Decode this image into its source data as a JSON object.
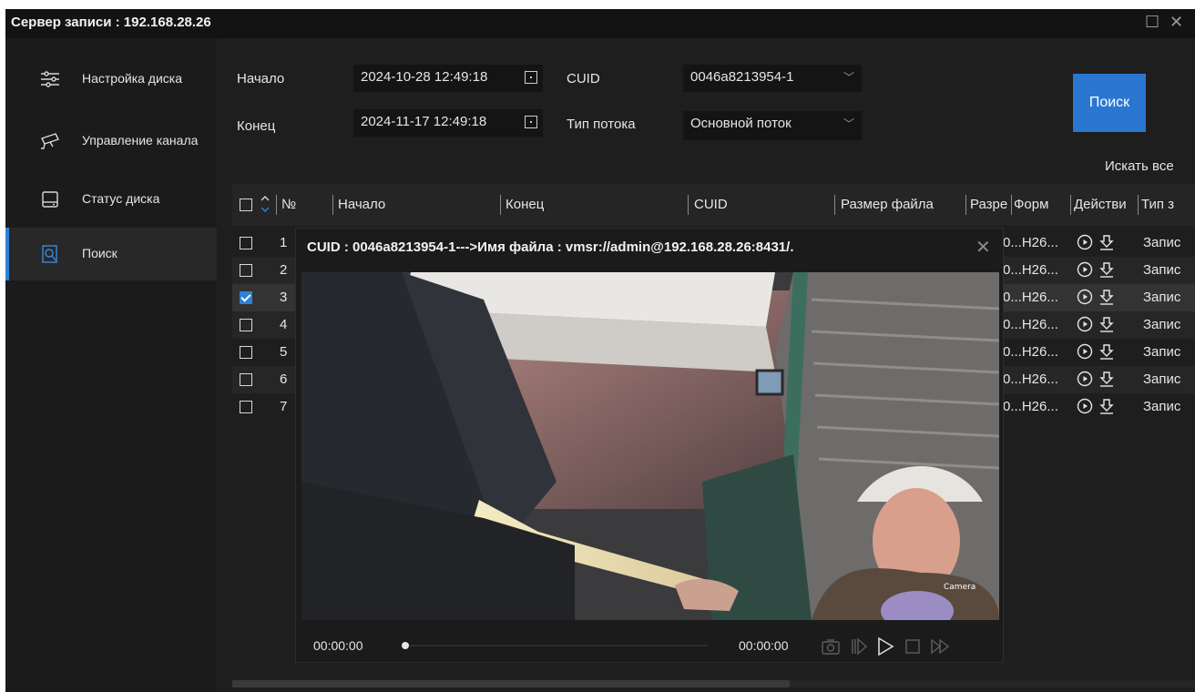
{
  "window": {
    "title": "Сервер записи : 192.168.28.26"
  },
  "sidebar": {
    "items": [
      {
        "label": "Настройка диска",
        "icon": "sliders-icon"
      },
      {
        "label": "Управление канала",
        "icon": "camera-icon"
      },
      {
        "label": "Статус диска",
        "icon": "disk-icon"
      },
      {
        "label": "Поиск",
        "icon": "search-doc-icon"
      }
    ]
  },
  "filters": {
    "start_label": "Начало",
    "start_value": "2024-10-28 12:49:18",
    "end_label": "Конец",
    "end_value": "2024-11-17 12:49:18",
    "cuid_label": "CUID",
    "cuid_value": "0046a8213954-1",
    "stream_label": "Тип потока",
    "stream_value": "Основной поток"
  },
  "search_button": "Поиск",
  "search_all": "Искать все",
  "table": {
    "columns": [
      "№",
      "Начало",
      "Конец",
      "CUID",
      "Размер файла",
      "Разре",
      "Форм",
      "Действи",
      "Тип з"
    ],
    "rows": [
      {
        "no": "1",
        "format": "0...H26...",
        "type": "Запис",
        "checked": false
      },
      {
        "no": "2",
        "format": "0...H26...",
        "type": "Запис",
        "checked": false
      },
      {
        "no": "3",
        "format": "0...H26...",
        "type": "Запис",
        "checked": true
      },
      {
        "no": "4",
        "format": "0...H26...",
        "type": "Запис",
        "checked": false
      },
      {
        "no": "5",
        "format": "0...H26...",
        "type": "Запис",
        "checked": false
      },
      {
        "no": "6",
        "format": "0...H26...",
        "type": "Запис",
        "checked": false
      },
      {
        "no": "7",
        "format": "0...H26...",
        "type": "Запис",
        "checked": false
      }
    ]
  },
  "player": {
    "title": "CUID : 0046a8213954-1--->Имя файла : vmsr://admin@192.168.28.26:8431/.",
    "time_current": "00:00:00",
    "time_total": "00:00:00",
    "video_watermark": "Camera",
    "progress": 0
  },
  "colors": {
    "accent": "#2a77d2",
    "background": "#1e1e1e",
    "sidebar": "#1b1b1b"
  }
}
